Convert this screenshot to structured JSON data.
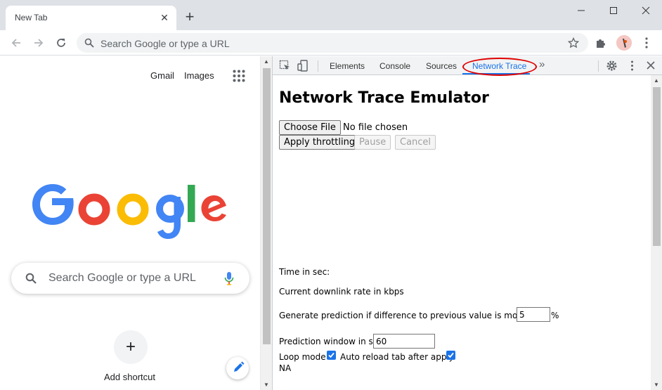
{
  "browser": {
    "tab": {
      "title": "New Tab",
      "close_glyph": "✕"
    },
    "new_tab_glyph": "+",
    "window_controls": {
      "minimize": "minimize-icon",
      "maximize": "maximize-icon",
      "close": "close-icon"
    },
    "omnibox": {
      "placeholder": "Search Google or type a URL"
    },
    "icons": [
      "back-arrow-icon",
      "forward-arrow-icon",
      "reload-icon",
      "search-icon",
      "star-icon",
      "extensions-puzzle-icon",
      "profile-avatar",
      "more-vert-icon"
    ]
  },
  "ntp": {
    "gmail": "Gmail",
    "images": "Images",
    "search_placeholder": "Search Google or type a URL",
    "add_shortcut_glyph": "+",
    "add_shortcut_label": "Add shortcut",
    "logo_colors": {
      "blue": "#4285F4",
      "red": "#EA4335",
      "yellow": "#FBBC05",
      "green": "#34A853"
    }
  },
  "devtools": {
    "tabs": [
      "Elements",
      "Console",
      "Sources",
      "Network Trace"
    ],
    "active_tab": "Network Trace",
    "more_tabs_glyph": "»",
    "highlight_color": "#e00000",
    "accent": "#1a73e8"
  },
  "emulator": {
    "title": "Network Trace Emulator",
    "choose_file": "Choose File",
    "file_status": "No file chosen",
    "apply": "Apply throttling",
    "pause": "Pause",
    "cancel": "Cancel",
    "time_label": "Time in sec:",
    "downlink_label": "Current downlink rate in kbps",
    "prediction_label": "Generate prediction if difference to previous value is more than",
    "prediction_value": "5",
    "percent": "%",
    "window_label": "Prediction window in sec",
    "window_value": "60",
    "loop_label": "Loop mode",
    "loop_checked": true,
    "autoreload_label": "Auto reload tab after apply",
    "autoreload_checked": true,
    "status": "NA"
  }
}
